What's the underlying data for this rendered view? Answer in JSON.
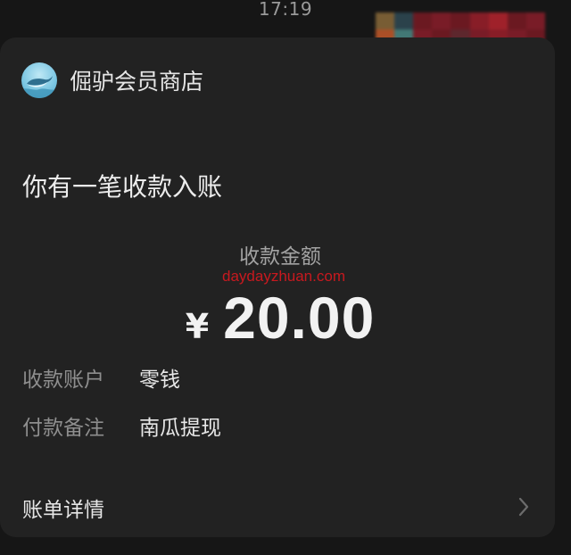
{
  "status_bar": {
    "time": "17:19"
  },
  "colors": {
    "background": "#161616",
    "card": "#222222",
    "watermark": "#c8191f",
    "mosaic": [
      "#3a3a3a",
      "#8a6a3a",
      "#2f4a55",
      "#7a1a24",
      "#8b1e2a",
      "#9c1f2b",
      "#b8242e",
      "#6a2a32",
      "#c55a2a",
      "#4a8a86",
      "#a32633"
    ]
  },
  "merchant": {
    "avatar_icon": "whale-logo-icon",
    "name": "倔驴会员商店"
  },
  "notice": {
    "title": "你有一笔收款入账"
  },
  "payment": {
    "amount_label": "收款金额",
    "watermark": "daydayzhuan.com",
    "currency_symbol": "¥",
    "amount": "20.00"
  },
  "details": [
    {
      "label": "收款账户",
      "value": "零钱"
    },
    {
      "label": "付款备注",
      "value": "南瓜提现"
    }
  ],
  "bill_link": {
    "label": "账单详情",
    "icon": "chevron-right-icon"
  }
}
